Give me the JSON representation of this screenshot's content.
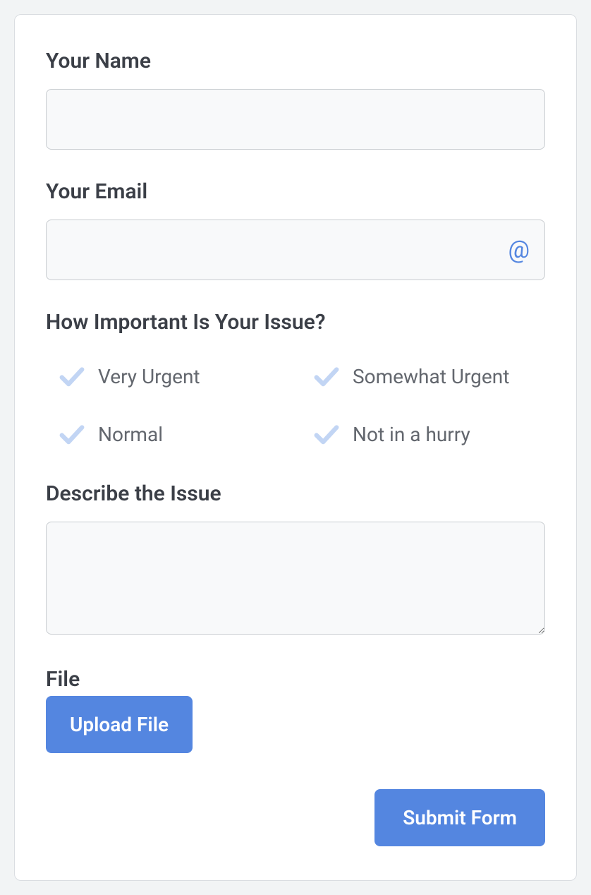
{
  "form": {
    "name": {
      "label": "Your Name",
      "value": ""
    },
    "email": {
      "label": "Your Email",
      "value": "",
      "iconGlyph": "@"
    },
    "importance": {
      "label": "How Important Is Your Issue?",
      "options": [
        {
          "label": "Very Urgent"
        },
        {
          "label": "Somewhat Urgent"
        },
        {
          "label": "Normal"
        },
        {
          "label": "Not in a hurry"
        }
      ]
    },
    "describe": {
      "label": "Describe the Issue",
      "value": ""
    },
    "file": {
      "label": "File",
      "button": "Upload File"
    },
    "submitLabel": "Submit Form"
  }
}
